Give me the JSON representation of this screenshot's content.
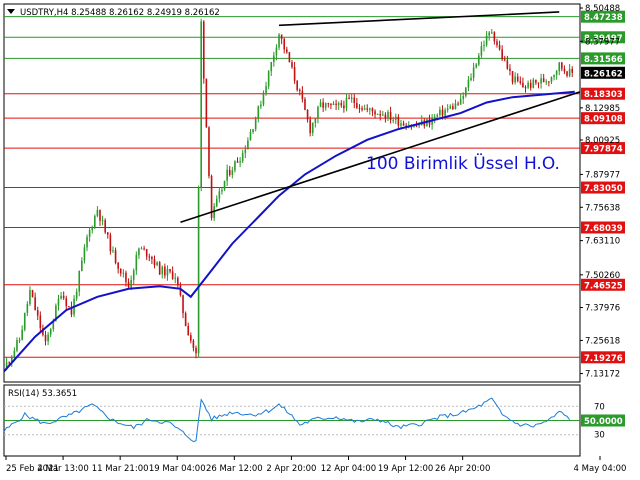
{
  "chart_data": {
    "type": "candlestick",
    "symbol_line": "USDTRY,H4  8.25488 8.26162 8.24919 8.26162",
    "annotation": "100 Birimlik Üssel H.O.",
    "price_axis": {
      "ylim": [
        7.1,
        8.52
      ],
      "ticks": [
        "8.50488",
        "8.37977",
        "8.12985",
        "8.00925",
        "7.87977",
        "7.75638",
        "7.63110",
        "7.50260",
        "7.37976",
        "7.25618",
        "7.13172"
      ]
    },
    "time_axis": {
      "ticks": [
        "25 Feb 2021",
        "4 Mar 13:00",
        "11 Mar 21:00",
        "19 Mar 04:00",
        "26 Mar 12:00",
        "2 Apr 20:00",
        "12 Apr 04:00",
        "19 Apr 12:00",
        "26 Apr 20:00",
        "4 May 04:00"
      ]
    },
    "horizontal_levels": [
      {
        "value": 8.47238,
        "label": "8.47238",
        "color": "#2a9a2a"
      },
      {
        "value": 8.39497,
        "label": "8.39497",
        "color": "#2a9a2a"
      },
      {
        "value": 8.31566,
        "label": "8.31566",
        "color": "#2a9a2a"
      },
      {
        "value": 8.18303,
        "label": "8.18303",
        "color": "#e01010"
      },
      {
        "value": 8.09108,
        "label": "8.09108",
        "color": "#e01010"
      },
      {
        "value": 7.97874,
        "label": "7.97874",
        "color": "#e01010"
      },
      {
        "value": 7.8305,
        "label": "7.83050",
        "color": "#e01010"
      },
      {
        "value": 7.68039,
        "label": "7.68039",
        "color": "#e01010"
      },
      {
        "value": 7.46525,
        "label": "7.46525",
        "color": "#e01010"
      },
      {
        "value": 7.19276,
        "label": "7.19276",
        "color": "#e01010"
      }
    ],
    "current_price": {
      "value": 8.26162,
      "label": "8.26162"
    },
    "close_path": [
      {
        "t": 0,
        "v": 7.15
      },
      {
        "t": 3,
        "v": 7.26
      },
      {
        "t": 5,
        "v": 7.44
      },
      {
        "t": 8,
        "v": 7.24
      },
      {
        "t": 11,
        "v": 7.44
      },
      {
        "t": 13,
        "v": 7.36
      },
      {
        "t": 16,
        "v": 7.64
      },
      {
        "t": 18,
        "v": 7.75
      },
      {
        "t": 21,
        "v": 7.58
      },
      {
        "t": 24,
        "v": 7.46
      },
      {
        "t": 26,
        "v": 7.6
      },
      {
        "t": 28,
        "v": 7.58
      },
      {
        "t": 30,
        "v": 7.52
      },
      {
        "t": 33,
        "v": 7.5
      },
      {
        "t": 35,
        "v": 7.32
      },
      {
        "t": 37,
        "v": 7.2
      },
      {
        "t": 38,
        "v": 8.45
      },
      {
        "t": 39,
        "v": 8.06
      },
      {
        "t": 40,
        "v": 7.72
      },
      {
        "t": 43,
        "v": 7.88
      },
      {
        "t": 46,
        "v": 7.96
      },
      {
        "t": 49,
        "v": 8.12
      },
      {
        "t": 51,
        "v": 8.26
      },
      {
        "t": 53,
        "v": 8.41
      },
      {
        "t": 55,
        "v": 8.3
      },
      {
        "t": 57,
        "v": 8.18
      },
      {
        "t": 59,
        "v": 8.05
      },
      {
        "t": 61,
        "v": 8.14
      },
      {
        "t": 64,
        "v": 8.13
      },
      {
        "t": 67,
        "v": 8.16
      },
      {
        "t": 70,
        "v": 8.12
      },
      {
        "t": 73,
        "v": 8.11
      },
      {
        "t": 76,
        "v": 8.08
      },
      {
        "t": 79,
        "v": 8.06
      },
      {
        "t": 82,
        "v": 8.08
      },
      {
        "t": 85,
        "v": 8.12
      },
      {
        "t": 88,
        "v": 8.15
      },
      {
        "t": 90,
        "v": 8.25
      },
      {
        "t": 92,
        "v": 8.36
      },
      {
        "t": 94,
        "v": 8.42
      },
      {
        "t": 96,
        "v": 8.32
      },
      {
        "t": 98,
        "v": 8.24
      },
      {
        "t": 100,
        "v": 8.21
      },
      {
        "t": 102,
        "v": 8.22
      },
      {
        "t": 105,
        "v": 8.24
      },
      {
        "t": 107,
        "v": 8.29
      },
      {
        "t": 109,
        "v": 8.26
      }
    ],
    "ema100": {
      "label": "100 Birimlik Üssel H.O.",
      "color": "#1212c8",
      "points": [
        {
          "t": 0,
          "v": 7.14
        },
        {
          "t": 6,
          "v": 7.27
        },
        {
          "t": 12,
          "v": 7.37
        },
        {
          "t": 18,
          "v": 7.42
        },
        {
          "t": 24,
          "v": 7.45
        },
        {
          "t": 30,
          "v": 7.46
        },
        {
          "t": 34,
          "v": 7.45
        },
        {
          "t": 36,
          "v": 7.42
        },
        {
          "t": 40,
          "v": 7.52
        },
        {
          "t": 44,
          "v": 7.62
        },
        {
          "t": 49,
          "v": 7.72
        },
        {
          "t": 53,
          "v": 7.8
        },
        {
          "t": 58,
          "v": 7.88
        },
        {
          "t": 64,
          "v": 7.95
        },
        {
          "t": 70,
          "v": 8.01
        },
        {
          "t": 76,
          "v": 8.05
        },
        {
          "t": 82,
          "v": 8.08
        },
        {
          "t": 88,
          "v": 8.11
        },
        {
          "t": 93,
          "v": 8.15
        },
        {
          "t": 98,
          "v": 8.17
        },
        {
          "t": 104,
          "v": 8.18
        },
        {
          "t": 110,
          "v": 8.19
        }
      ]
    },
    "trendlines": [
      {
        "name": "support",
        "from": {
          "t": 34,
          "v": 7.7
        },
        "to": {
          "t": 111,
          "v": 8.19
        },
        "color": "#000000"
      },
      {
        "name": "resistance",
        "from": {
          "t": 53,
          "v": 8.44
        },
        "to": {
          "t": 107,
          "v": 8.49
        },
        "color": "#000000"
      }
    ],
    "rsi": {
      "label": "RSI(14) 53.3651",
      "ylim": [
        0,
        100
      ],
      "ticks": [
        "70",
        "30"
      ],
      "level": {
        "value": 50,
        "label": "50.0000",
        "color": "#2a9a2a"
      },
      "points": [
        {
          "t": 0,
          "v": 35
        },
        {
          "t": 4,
          "v": 58
        },
        {
          "t": 8,
          "v": 45
        },
        {
          "t": 13,
          "v": 58
        },
        {
          "t": 17,
          "v": 72
        },
        {
          "t": 21,
          "v": 50
        },
        {
          "t": 25,
          "v": 40
        },
        {
          "t": 28,
          "v": 52
        },
        {
          "t": 32,
          "v": 46
        },
        {
          "t": 35,
          "v": 30
        },
        {
          "t": 37,
          "v": 20
        },
        {
          "t": 38,
          "v": 80
        },
        {
          "t": 40,
          "v": 52
        },
        {
          "t": 44,
          "v": 62
        },
        {
          "t": 48,
          "v": 58
        },
        {
          "t": 51,
          "v": 64
        },
        {
          "t": 53,
          "v": 72
        },
        {
          "t": 55,
          "v": 60
        },
        {
          "t": 57,
          "v": 44
        },
        {
          "t": 60,
          "v": 52
        },
        {
          "t": 64,
          "v": 55
        },
        {
          "t": 68,
          "v": 48
        },
        {
          "t": 72,
          "v": 52
        },
        {
          "t": 76,
          "v": 40
        },
        {
          "t": 80,
          "v": 45
        },
        {
          "t": 84,
          "v": 55
        },
        {
          "t": 88,
          "v": 60
        },
        {
          "t": 91,
          "v": 68
        },
        {
          "t": 94,
          "v": 80
        },
        {
          "t": 96,
          "v": 58
        },
        {
          "t": 99,
          "v": 45
        },
        {
          "t": 102,
          "v": 42
        },
        {
          "t": 105,
          "v": 50
        },
        {
          "t": 107,
          "v": 62
        },
        {
          "t": 109,
          "v": 53
        }
      ]
    }
  },
  "colors": {
    "bull": "#2a9a2a",
    "bear": "#c01010",
    "ema": "#1212c8",
    "rsi_line": "#1c7cd6",
    "grid_dots": "#bbbbbb",
    "current_badge_bg": "#000000",
    "current_badge_fg": "#ffffff"
  }
}
